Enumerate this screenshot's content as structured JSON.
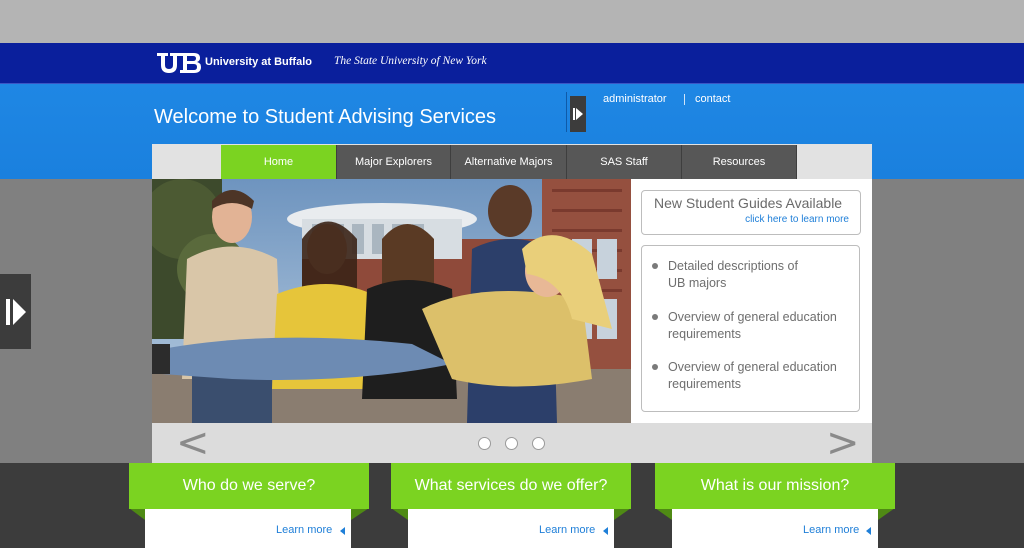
{
  "brand": {
    "logo": "UB",
    "name": "University at Buffalo",
    "tagline": "The State University of New York"
  },
  "header": {
    "title": "Welcome to Student Advising Services",
    "links": [
      "administrator",
      "contact"
    ],
    "toggle_icon": "expand-arrow-icon"
  },
  "nav": {
    "tabs": [
      {
        "label": "Home",
        "active": true
      },
      {
        "label": "Major Explorers",
        "active": false
      },
      {
        "label": "Alternative Majors",
        "active": false
      },
      {
        "label": "SAS Staff",
        "active": false
      },
      {
        "label": "Resources",
        "active": false
      }
    ]
  },
  "guide": {
    "title": "New Student Guides Available",
    "link": "click here to learn more"
  },
  "features": [
    "Detailed descriptions of UB majors",
    "Overview of general education requirements",
    "Overview of general education requirements"
  ],
  "slider": {
    "prev": "<",
    "next": ">",
    "dots": 3
  },
  "cards": [
    {
      "title": "Who do we serve?",
      "link": "Learn more"
    },
    {
      "title": "What services do we offer?",
      "link": "Learn more"
    },
    {
      "title": "What is our mission?",
      "link": "Learn more"
    }
  ],
  "colors": {
    "ub_blue": "#0a1f9c",
    "header_blue": "#1f87e4",
    "accent_green": "#7bd321",
    "nav_gray": "#575757",
    "link_blue": "#1f7fd8"
  }
}
